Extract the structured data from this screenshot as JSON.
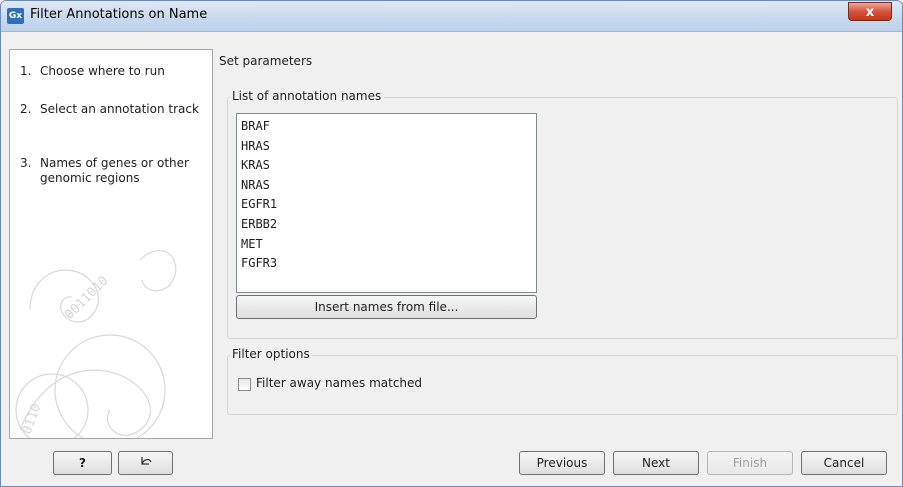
{
  "window": {
    "title": "Filter Annotations on Name",
    "app_icon": "Gx",
    "close_label": "x"
  },
  "steps": [
    {
      "num": "1.",
      "label": "Choose where to run"
    },
    {
      "num": "2.",
      "label": "Select an annotation track"
    },
    {
      "num": "3.",
      "label": "Names of genes or other genomic regions"
    }
  ],
  "main": {
    "section_title": "Set parameters",
    "names_group": {
      "label": "List of annotation names",
      "names": [
        "BRAF",
        "HRAS",
        "KRAS",
        "NRAS",
        "EGFR1",
        "ERBB2",
        "MET",
        "FGFR3"
      ],
      "insert_button": "Insert names from file..."
    },
    "filter_group": {
      "label": "Filter options",
      "checkbox_label": "Filter away names matched",
      "checked": false
    }
  },
  "footer": {
    "help_label": "?",
    "reset_icon": "reset-arrow-icon",
    "previous": "Previous",
    "next": "Next",
    "finish": "Finish",
    "cancel": "Cancel"
  }
}
